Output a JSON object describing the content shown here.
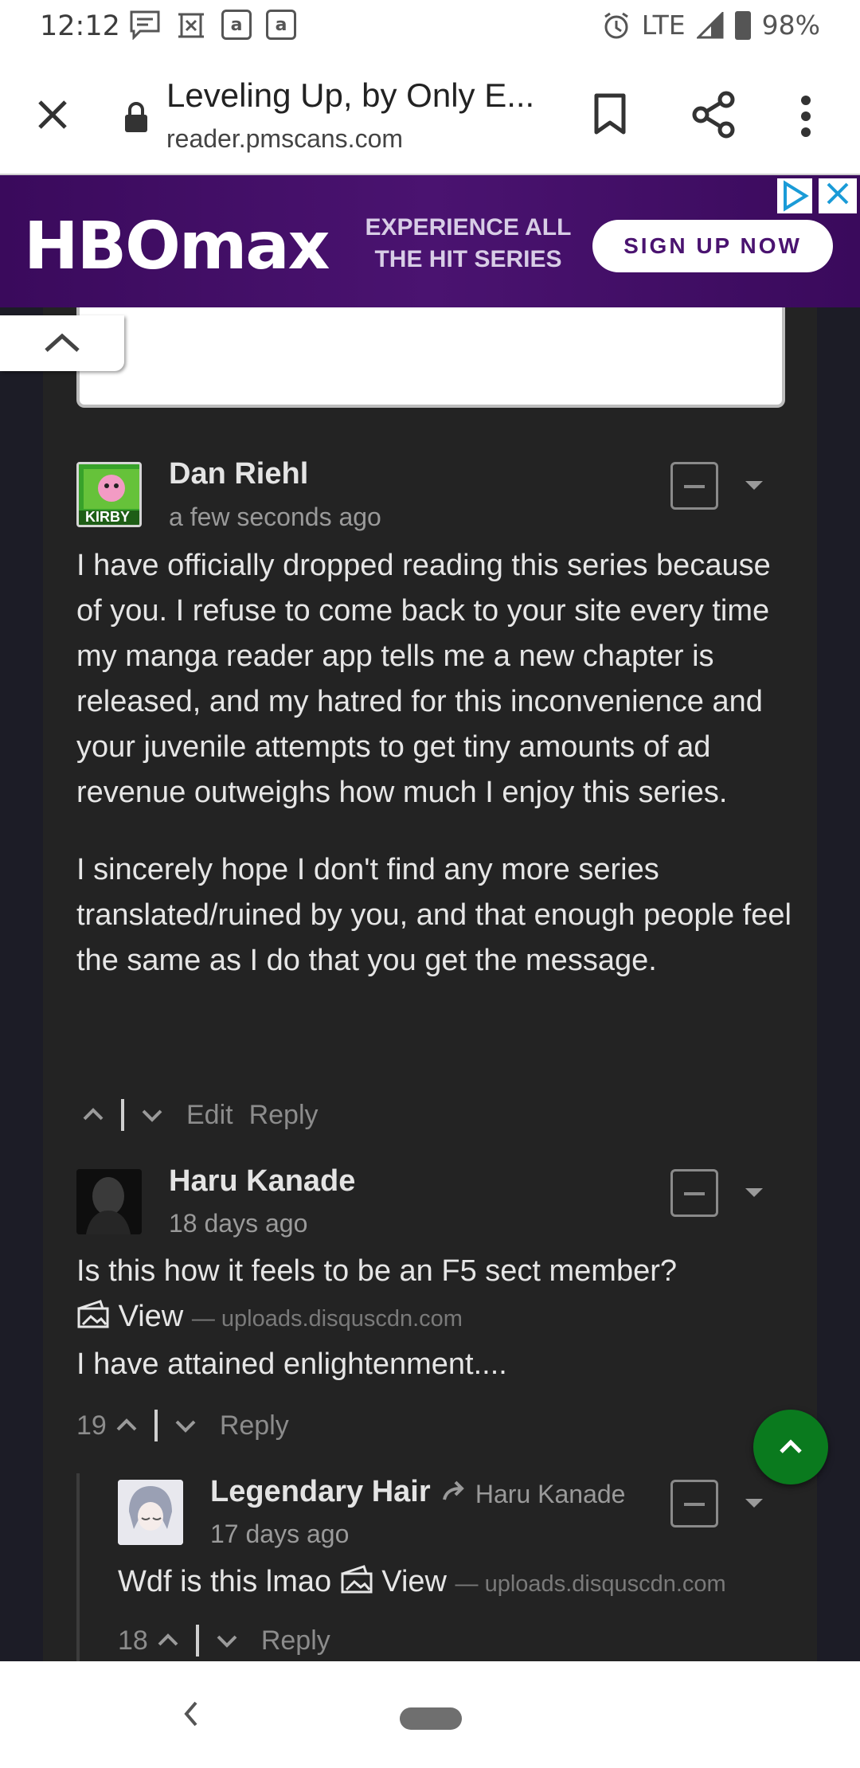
{
  "status_bar": {
    "time": "12:12",
    "network": "LTE",
    "battery": "98%"
  },
  "browser": {
    "title": "Leveling Up, by Only E...",
    "url": "reader.pmscans.com"
  },
  "ad": {
    "brand": "HBOmax",
    "tagline": "EXPERIENCE ALL THE HIT SERIES",
    "cta": "SIGN UP NOW"
  },
  "comments": [
    {
      "author": "Dan Riehl",
      "avatar_label": "KIRBY",
      "time": "a few seconds ago",
      "paragraphs": [
        "I have officially dropped reading this series because of you. I refuse to come back to your site every time my manga reader app tells me a new chapter is released, and my hatred for this inconvenience and your juvenile attempts to get tiny amounts of ad revenue outweighs how much I enjoy this series.",
        "I sincerely hope I don't find any more series translated/ruined by you, and that enough people feel the same as I do that you get the message."
      ],
      "actions": {
        "edit": "Edit",
        "reply": "Reply"
      }
    },
    {
      "author": "Haru Kanade",
      "time": "18 days ago",
      "line1": "Is this how it feels to be an F5 sect member?",
      "view": "View",
      "media_source": "— uploads.disquscdn.com",
      "line2": "I have attained enlightenment....",
      "votes": "19",
      "actions": {
        "reply": "Reply"
      }
    },
    {
      "author": "Legendary Hair",
      "reply_to": "Haru Kanade",
      "time": "17 days ago",
      "text": "Wdf is this lmao",
      "view": "View",
      "media_source": "— uploads.disquscdn.com",
      "votes": "18",
      "actions": {
        "reply": "Reply"
      }
    }
  ],
  "colors": {
    "accent_green": "#0a7a1e",
    "ad_purple": "#4a1370",
    "panel": "#232323"
  }
}
